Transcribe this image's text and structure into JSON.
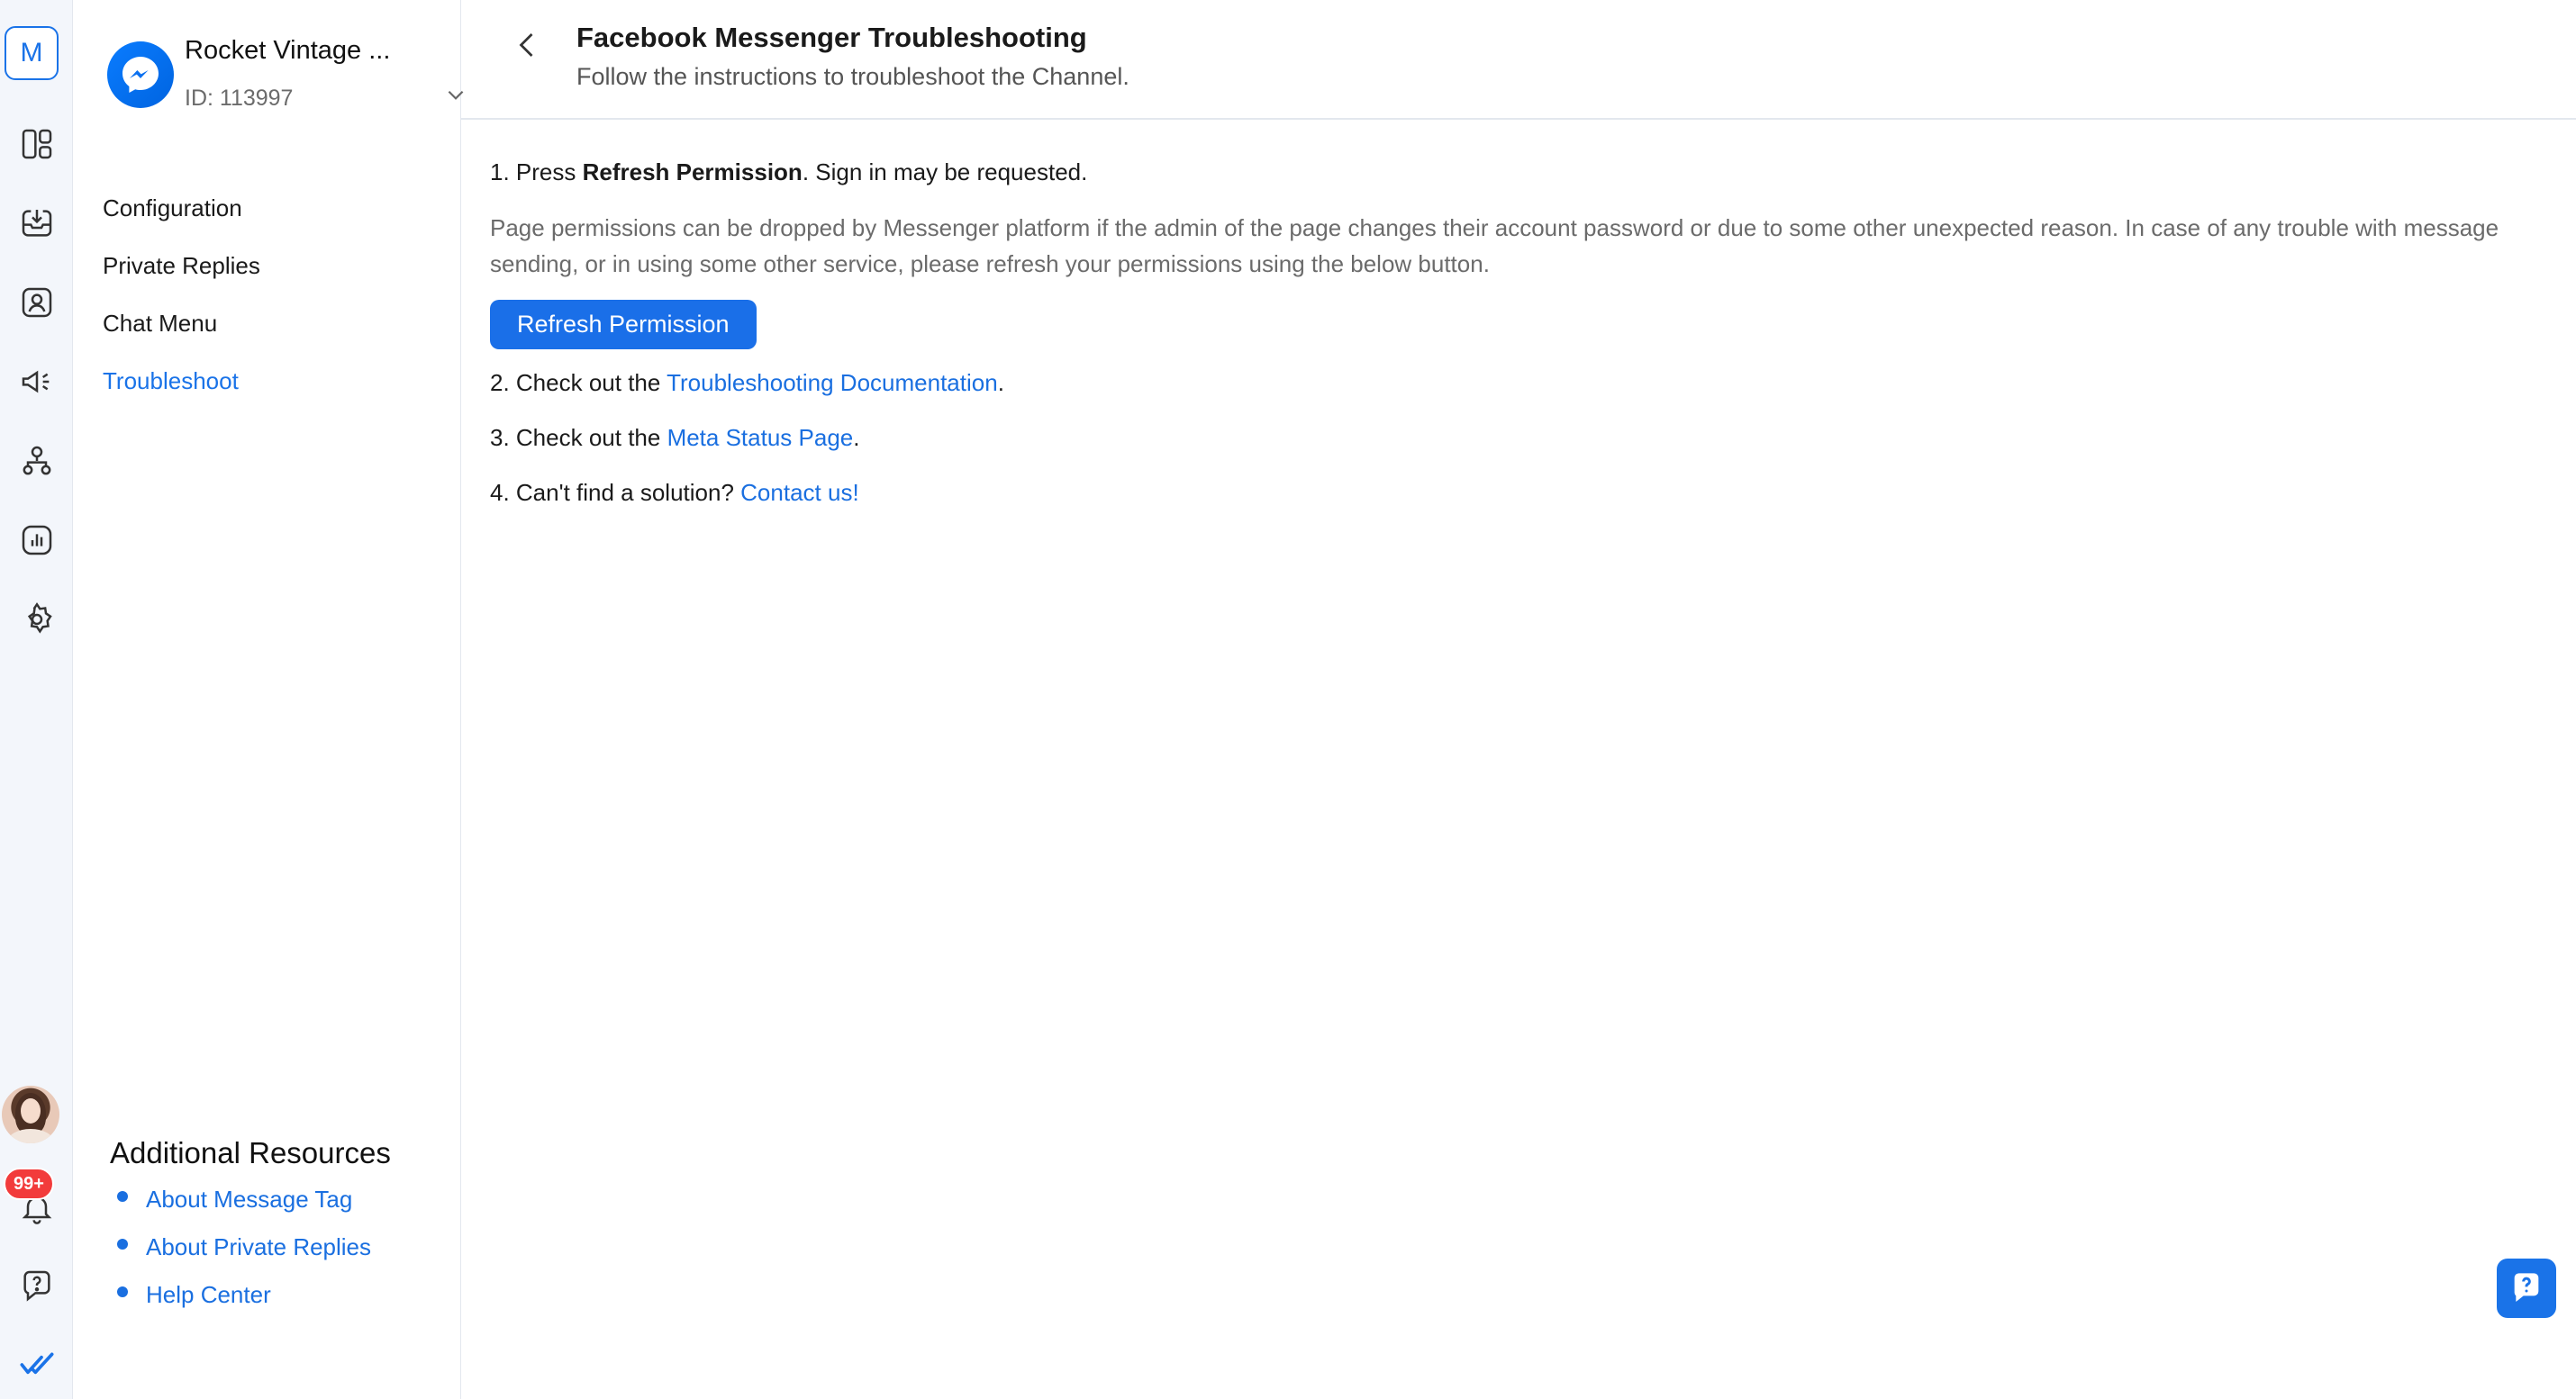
{
  "rail": {
    "workspace_letter": "M",
    "notification_count": "99+",
    "icons": [
      "layout-icon",
      "inbox-icon",
      "contacts-icon",
      "broadcast-icon",
      "workflows-icon",
      "reports-icon",
      "settings-icon",
      "notifications-icon",
      "help-icon",
      "brand-logo-icon"
    ]
  },
  "channel": {
    "name": "Rocket Vintage ...",
    "id": "ID: 113997",
    "icon": "messenger-icon"
  },
  "nav": {
    "items": [
      {
        "label": "Configuration"
      },
      {
        "label": "Private Replies"
      },
      {
        "label": "Chat Menu"
      },
      {
        "label": "Troubleshoot"
      }
    ],
    "active": "Troubleshoot"
  },
  "resources": {
    "title": "Additional Resources",
    "items": [
      {
        "label": "About Message Tag"
      },
      {
        "label": "About Private Replies"
      },
      {
        "label": "Help Center"
      }
    ]
  },
  "header": {
    "title": "Facebook Messenger Troubleshooting",
    "subtitle": "Follow the instructions to troubleshoot the Channel."
  },
  "steps": {
    "step1": {
      "prefix": "1. Press ",
      "bold": "Refresh Permission",
      "suffix": ". Sign in may be requested."
    },
    "description": "Page permissions can be dropped by Messenger platform if the admin of the page changes their account password or due to some other unexpected reason. In case of any trouble with message sending, or in using some other service, please refresh your permissions using the below button.",
    "refresh_button": "Refresh Permission",
    "step2": {
      "prefix": "2. Check out the ",
      "link": "Troubleshooting Documentation",
      "suffix": "."
    },
    "step3": {
      "prefix": "3. Check out the ",
      "link": "Meta Status Page",
      "suffix": "."
    },
    "step4": {
      "prefix": "4. Can't find a solution? ",
      "link": "Contact us!"
    }
  },
  "colors": {
    "accent": "#1a73e8",
    "badge": "#f23b3b",
    "rail_bg": "#f3f6fb"
  }
}
